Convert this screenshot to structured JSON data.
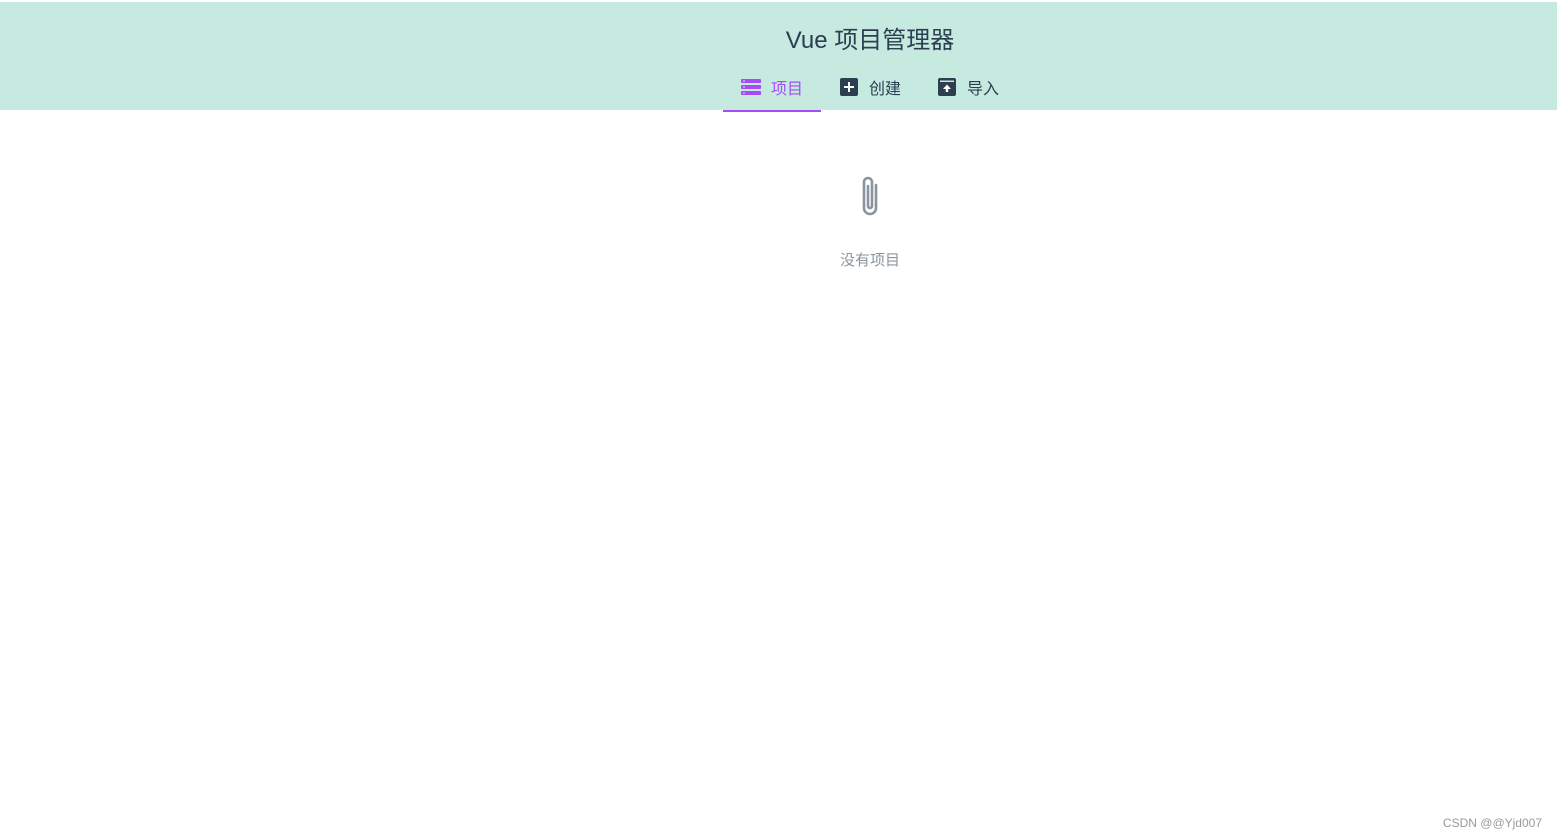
{
  "header": {
    "title": "Vue 项目管理器"
  },
  "tabs": [
    {
      "label": "项目",
      "icon": "list-icon",
      "active": true
    },
    {
      "label": "创建",
      "icon": "plus-box-icon",
      "active": false
    },
    {
      "label": "导入",
      "icon": "archive-upload-icon",
      "active": false
    }
  ],
  "empty_state": {
    "icon": "paperclip-icon",
    "message": "没有项目"
  },
  "watermark": "CSDN @@Yjd007",
  "colors": {
    "header_bg": "#c6eadf",
    "accent": "#a44cf5",
    "text_dark": "#2c3e50",
    "muted": "#8a949e"
  }
}
